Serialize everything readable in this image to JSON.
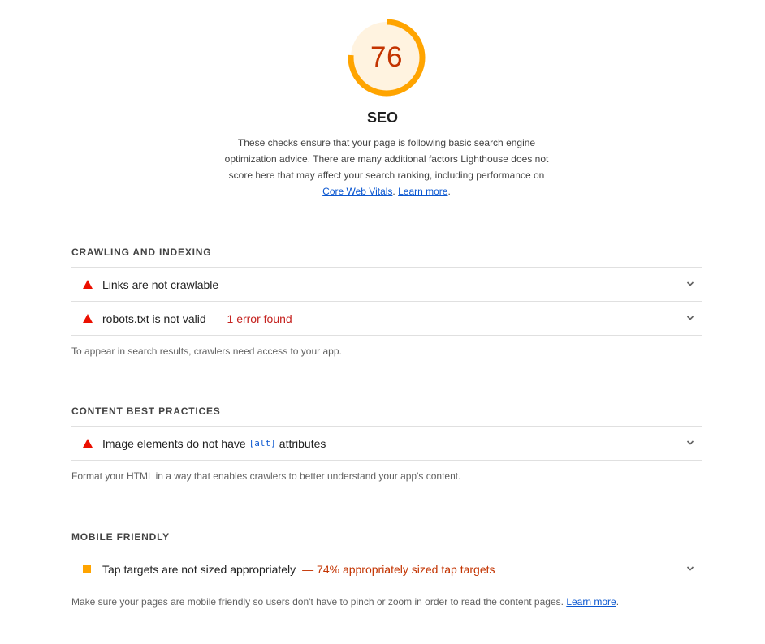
{
  "category": {
    "score": "76",
    "title": "SEO",
    "description_text": "These checks ensure that your page is following basic search engine optimization advice. There are many additional factors Lighthouse does not score here that may affect your search ranking, including performance on",
    "description_link": "Core Web Vitals",
    "description_sep": ".",
    "learn_more": "Learn more",
    "description_end": "."
  },
  "gauge": {
    "fraction": 0.76,
    "color": "#ffa400",
    "fill": "#fff3e0",
    "text_color": "#c33300"
  },
  "groups": [
    {
      "title": "CRAWLING AND INDEXING",
      "audits": [
        {
          "status": "fail",
          "title": "Links are not crawlable",
          "display_value": ""
        },
        {
          "status": "fail",
          "title": "robots.txt is not valid",
          "display_value": "— 1 error found"
        }
      ],
      "description": "To appear in search results, crawlers need access to your app."
    },
    {
      "title": "CONTENT BEST PRACTICES",
      "audits": [
        {
          "status": "fail",
          "title_before": "Image elements do not have",
          "code": "[alt]",
          "title_after": "attributes"
        }
      ],
      "description": "Format your HTML in a way that enables crawlers to better understand your app's content."
    },
    {
      "title": "MOBILE FRIENDLY",
      "audits": [
        {
          "status": "average",
          "title": "Tap targets are not sized appropriately",
          "display_value": "— 74% appropriately sized tap targets"
        }
      ],
      "description": "Make sure your pages are mobile friendly so users don't have to pinch or zoom in order to read the content pages.",
      "learn_more": "Learn more",
      "description_end": "."
    }
  ],
  "colors": {
    "fail": "#eb0f00",
    "average": "#ffa400",
    "link": "#0b57d0"
  },
  "icons": {
    "fail": "triangle-fail-icon",
    "average": "square-average-icon",
    "expand": "chevron-down-icon"
  }
}
